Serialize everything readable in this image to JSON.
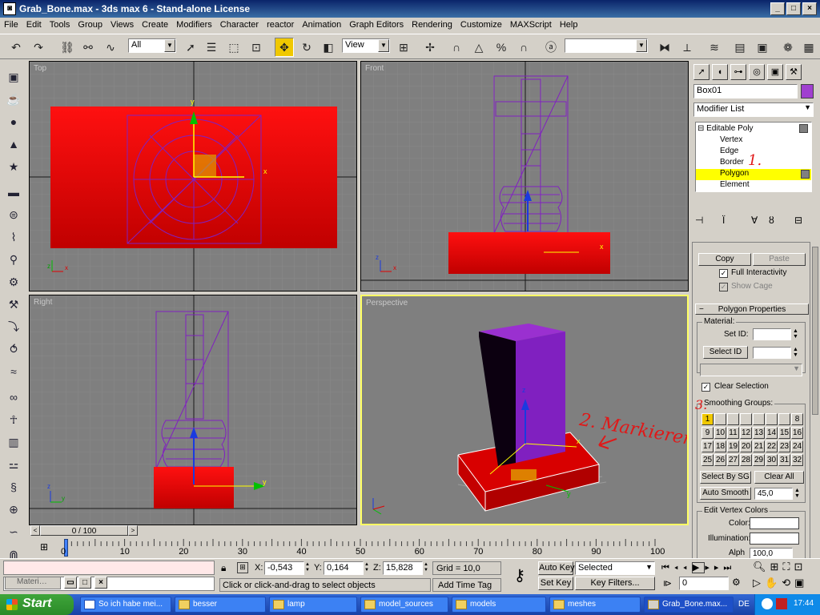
{
  "window": {
    "title": "Grab_Bone.max - 3ds max 6 - Stand-alone License",
    "min": "_",
    "max": "□",
    "close": "×"
  },
  "menu": [
    "File",
    "Edit",
    "Tools",
    "Group",
    "Views",
    "Create",
    "Modifiers",
    "Character",
    "reactor",
    "Animation",
    "Graph Editors",
    "Rendering",
    "Customize",
    "MAXScript",
    "Help"
  ],
  "toolbar": {
    "filter": "All",
    "refcoord": "View",
    "named_sel": ""
  },
  "viewports": {
    "top": "Top",
    "front": "Front",
    "right": "Right",
    "perspective": "Perspective"
  },
  "axes": {
    "x": "x",
    "y": "y",
    "z": "z"
  },
  "cmd": {
    "object_name": "Box01",
    "object_color": "#a040d0",
    "modifier_list": "Modifier List",
    "stack": [
      "Editable Poly",
      "Vertex",
      "Edge",
      "Border",
      "Polygon",
      "Element"
    ],
    "selected": "Polygon",
    "copy": "Copy",
    "paste": "Paste",
    "full_interactivity": "Full Interactivity",
    "show_cage": "Show Cage",
    "rollout": "Polygon Properties",
    "material_group": "Material:",
    "set_id": "Set ID:",
    "select_id": "Select ID",
    "clear_selection": "Clear Selection",
    "smoothing_groups": "Smoothing Groups:",
    "sg_numbers": [
      "1",
      "2",
      "3",
      "4",
      "5",
      "6",
      "7",
      "8",
      "9",
      "10",
      "11",
      "12",
      "13",
      "14",
      "15",
      "16",
      "17",
      "18",
      "19",
      "20",
      "21",
      "22",
      "23",
      "24",
      "25",
      "26",
      "27",
      "28",
      "29",
      "30",
      "31",
      "32"
    ],
    "select_by_sg": "Select By SG",
    "clear_all": "Clear All",
    "auto_smooth": "Auto Smooth",
    "auto_smooth_value": "45,0",
    "edit_vertex_colors": "Edit Vertex Colors",
    "color": "Color:",
    "illumination": "Illumination:",
    "alpha_label": "Alpha:",
    "alpha_value": "100,0"
  },
  "annotations": {
    "step1": "1.",
    "step2": "2. Markieren",
    "step3": "3."
  },
  "timeline": {
    "frame": "0 / 100",
    "ticks": [
      "0",
      "10",
      "20",
      "30",
      "40",
      "50",
      "60",
      "70",
      "80",
      "90",
      "100"
    ]
  },
  "status": {
    "script": "Materi…",
    "x_label": "X:",
    "x": "-0,543",
    "y_label": "Y:",
    "y": "0,164",
    "z_label": "Z:",
    "z": "15,828",
    "grid": "Grid = 10,0",
    "prompt": "Click or click-and-drag to select objects",
    "add_time_tag": "Add Time Tag",
    "auto_key": "Auto Key",
    "set_key": "Set Key",
    "selected": "Selected",
    "key_filters": "Key Filters...",
    "frame_field": "0"
  },
  "taskbar": {
    "start": "Start",
    "items": [
      "So ich habe mei...",
      "besser",
      "lamp",
      "model_sources",
      "models",
      "meshes",
      "Grab_Bone.max..."
    ],
    "lang": "DE",
    "clock": "17:44"
  },
  "colors": {
    "highlight": "#ffff00",
    "viewport": "#7f7f7f",
    "red": "#e00000",
    "purple": "#8020c0"
  }
}
